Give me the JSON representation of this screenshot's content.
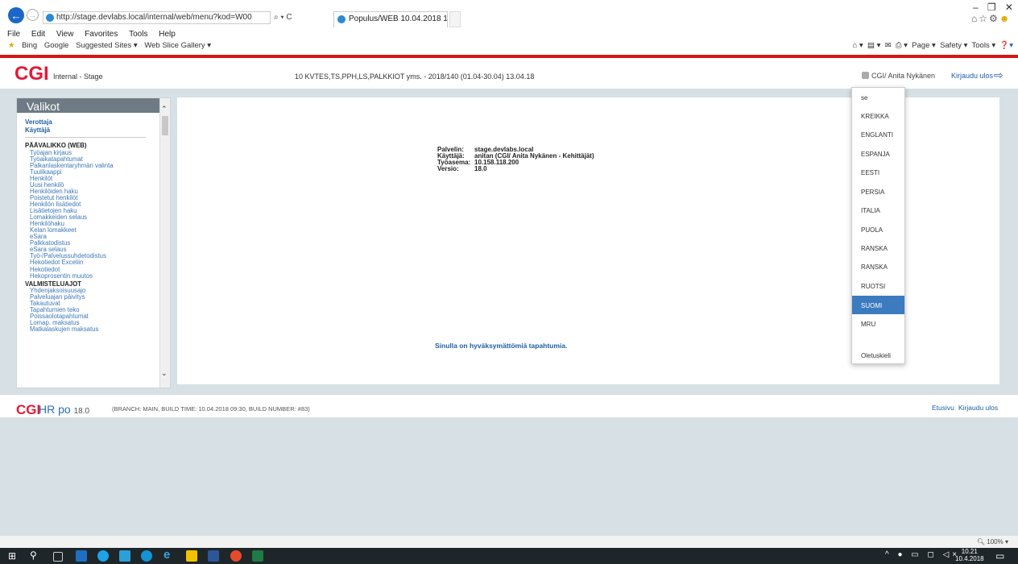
{
  "browser": {
    "url": "http://stage.devlabs.local/internal/web/menu?kod=W00",
    "address_tools": "⌕ ▾ C",
    "tab_title": "Populus/WEB 10.04.2018 10...",
    "tab_close": "×",
    "window_controls": [
      "–",
      "❐",
      "✕"
    ],
    "menu": [
      "File",
      "Edit",
      "View",
      "Favorites",
      "Tools",
      "Help"
    ],
    "favorites": [
      "Bing",
      "Google",
      "Suggested Sites ▾",
      "Web Slice Gallery ▾"
    ],
    "commands": [
      "Page ▾",
      "Safety ▾",
      "Tools ▾"
    ],
    "zoom": "100%"
  },
  "header": {
    "logo": "CGI",
    "environment": "Internal - Stage",
    "period": "10 KVTES,TS,PPH,LS,PALKKIOT yms. - 2018/140 (01.04-30.04) 13.04.18",
    "user": "CGI/ Anita Nykänen",
    "logout": "Kirjaudu ulos"
  },
  "sidebar": {
    "title": "Valikot",
    "top_links": [
      "Verottaja",
      "Käyttäjä"
    ],
    "sections": [
      {
        "title": "PÄÄVALIKKO (WEB)",
        "items": [
          "Työajan kirjaus",
          "Työaikatapahtumat",
          "Palkanlaskentaryhmän valinta",
          "Tuulikaappi",
          "Henkilöt",
          "Uusi henkilö",
          "Henkilöiden haku",
          "Poistetut henkilöt",
          "Henkilön lisätiedot",
          "Lisätietojen haku",
          "Lomakkeiden selaus",
          "Henkilöhaku",
          "Kelan lomakkeet",
          "eSara",
          "Palkkatodistus",
          "eSara selaus",
          "Työ-/Palvelussuhdetodistus",
          "Hekotiedot Exceliin",
          "Hekotiedot",
          "Hekoprosentin muutos"
        ]
      },
      {
        "title": "VALMISTELUAJOT",
        "items": [
          "Yhdenjaksoisuusajo",
          "Palveluajan päivitys",
          "Takautuvat",
          "Tapahtumien teko",
          "Poissaolotapahtumat",
          "Lomap. maksatus",
          "Matkalaskujen maksatus"
        ]
      }
    ]
  },
  "main": {
    "info": [
      {
        "label": "Palvelin:",
        "value": "stage.devlabs.local"
      },
      {
        "label": "Käyttäjä:",
        "value": "anitan (CGI/ Anita Nykänen - Kehittäjät)"
      },
      {
        "label": "Työasema:",
        "value": "10.158.118.200"
      },
      {
        "label": "Versio:",
        "value": "18.0"
      }
    ],
    "notice": "Sinulla on hyväksymättömiä tapahtumia."
  },
  "language_menu": {
    "items": [
      "se",
      "KREIKKA",
      "ENGLANTI",
      "ESPANJA",
      "EESTI",
      "PERSIA",
      "ITALIA",
      "PUOLA",
      "RANSKA",
      "RANSKA",
      "RUOTSI",
      "SUOMI",
      "MRU",
      "",
      "Oletuskieli"
    ],
    "selected": "SUOMI",
    "selected_color": "#3c7bbf"
  },
  "footer": {
    "logo": "CGI",
    "product": "HR po",
    "version": "18.0",
    "build": "(BRANCH: MAIN, BUILD TIME: 10.04.2018 09:30, BUILD NUMBER: #83)",
    "home": "Etusivu",
    "logout": "Kirjaudu ulos"
  },
  "taskbar": {
    "time": "10.21",
    "date": "10.4.2018"
  },
  "colors": {
    "brand_red": "#e31937",
    "link_blue": "#1f5fa3",
    "page_bg": "#d7e0e5",
    "sidebar_header": "#6e7b85"
  }
}
